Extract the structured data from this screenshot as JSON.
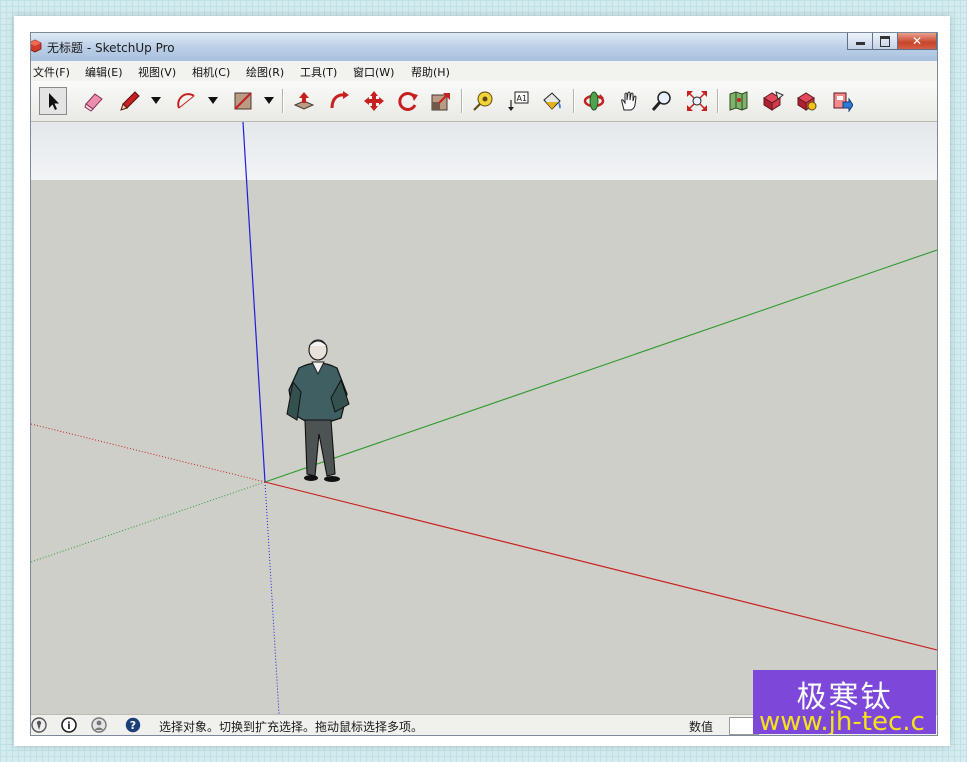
{
  "window": {
    "title": "无标题 - SketchUp Pro",
    "controls": {
      "minimize": "minimize",
      "maximize": "maximize",
      "close": "✕"
    }
  },
  "menu": [
    {
      "label": "文件(F)"
    },
    {
      "label": "编辑(E)"
    },
    {
      "label": "视图(V)"
    },
    {
      "label": "相机(C)"
    },
    {
      "label": "绘图(R)"
    },
    {
      "label": "工具(T)"
    },
    {
      "label": "窗口(W)"
    },
    {
      "label": "帮助(H)"
    }
  ],
  "toolbar": {
    "tools": [
      "select-icon",
      "eraser-icon",
      "pencil-icon",
      "arc-icon",
      "rectangle-icon",
      "push-pull-icon",
      "follow-me-icon",
      "move-icon",
      "rotate-icon",
      "scale-icon",
      "tape-measure-icon",
      "text-icon",
      "paint-bucket-icon",
      "orbit-icon",
      "pan-icon",
      "zoom-icon",
      "zoom-extents-icon",
      "3d-warehouse-icon",
      "share-model-icon",
      "get-models-icon",
      "send-to-layout-icon"
    ],
    "selected": "select-icon"
  },
  "scene": {
    "axis_colors": {
      "blue": "#1f1fd6",
      "green": "#2f9a2f",
      "red": "#c72020"
    },
    "figure": "person-figure"
  },
  "status": {
    "icons": [
      "geo-location-icon",
      "credits-icon",
      "user-icon",
      "help-icon"
    ],
    "help_glyph": "?",
    "info_glyph": "i",
    "message": "选择对象。切换到扩充选择。拖动鼠标选择多项。",
    "measurement_label": "数值"
  },
  "watermark": {
    "title": "极寒钛",
    "url": "www.jh-tec.c"
  }
}
